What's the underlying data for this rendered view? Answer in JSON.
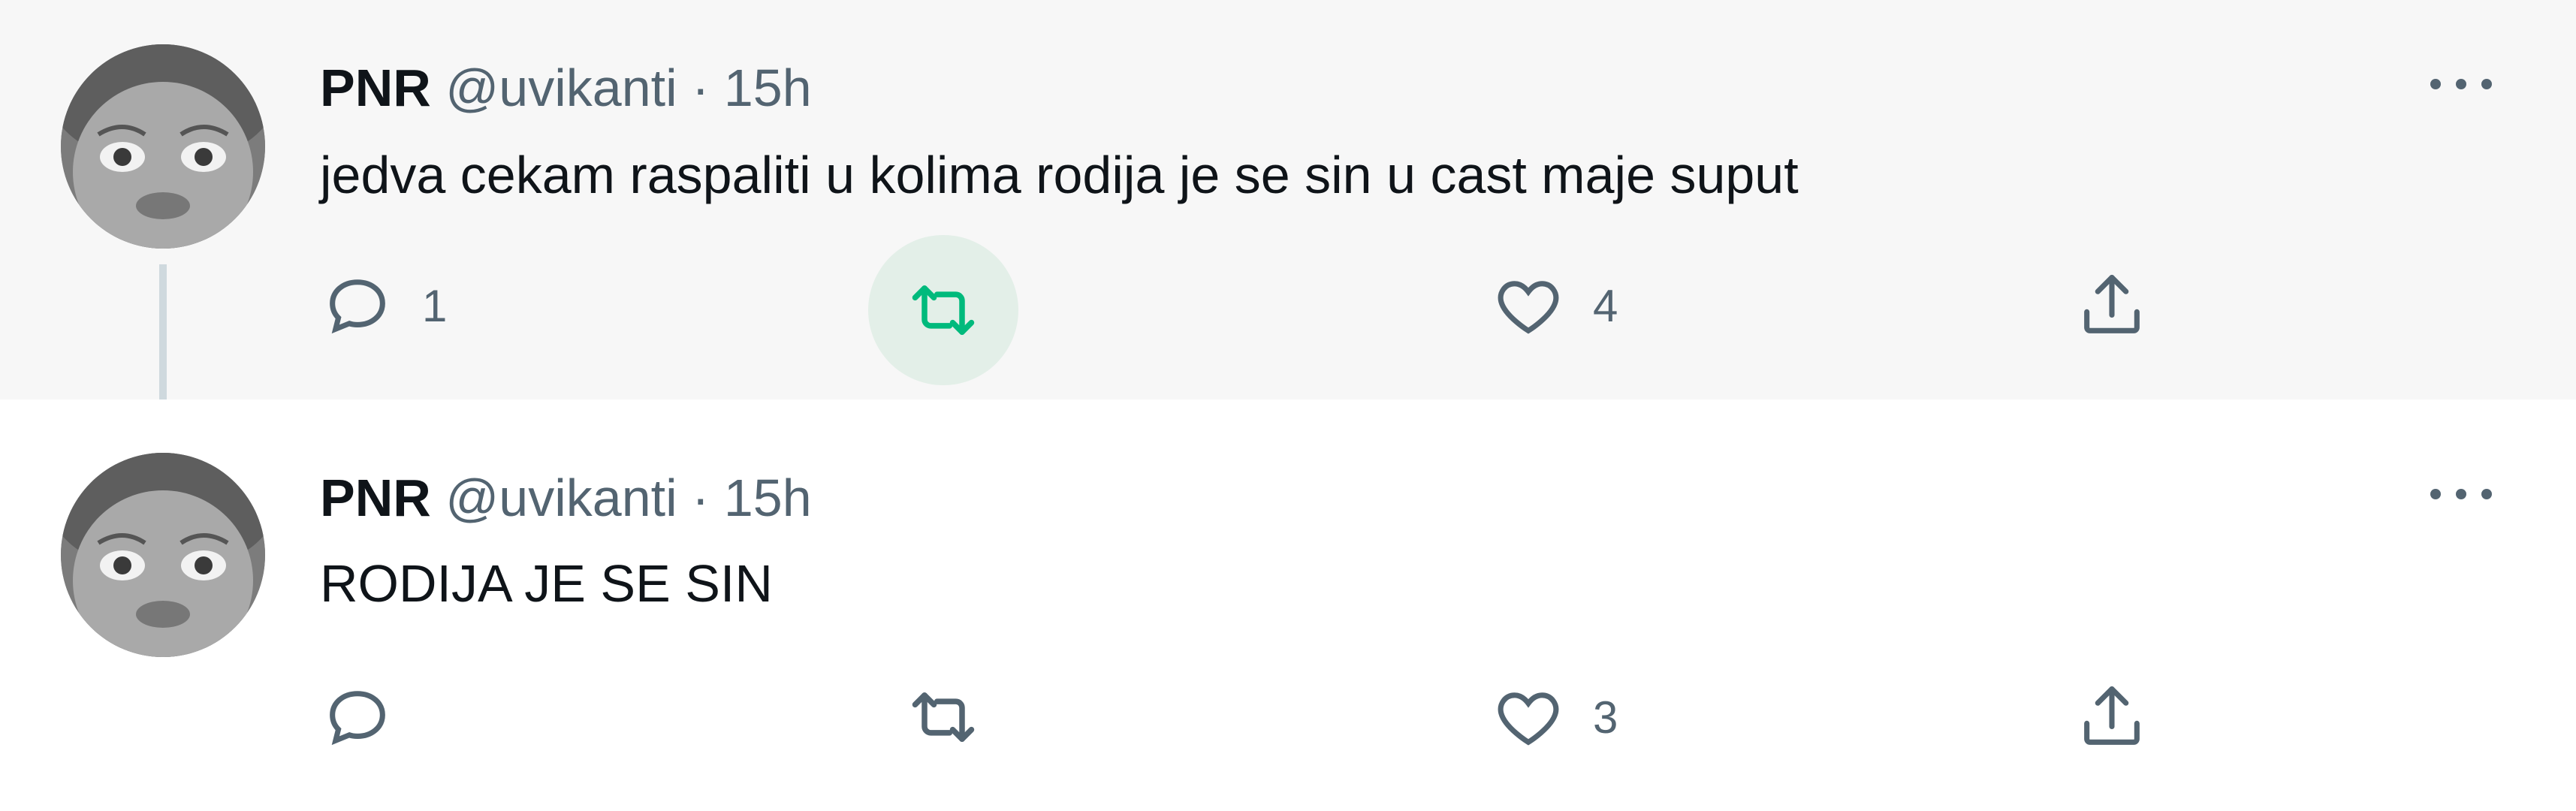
{
  "tweets": [
    {
      "name": "PNR",
      "handle": "@uvikanti",
      "separator": "·",
      "time": "15h",
      "text": "jedva cekam raspaliti u kolima rodija je se sin u cast maje suput",
      "reply_count": "1",
      "retweet_count": "",
      "like_count": "4",
      "retweet_color": "#00ba7c"
    },
    {
      "name": "PNR",
      "handle": "@uvikanti",
      "separator": "·",
      "time": "15h",
      "text": "RODIJA JE SE SIN",
      "reply_count": "",
      "retweet_count": "",
      "like_count": "3",
      "retweet_color": "#536471"
    }
  ],
  "icons": {
    "more": "more-icon",
    "reply": "reply-icon",
    "retweet": "retweet-icon",
    "like": "like-icon",
    "share": "share-icon"
  }
}
